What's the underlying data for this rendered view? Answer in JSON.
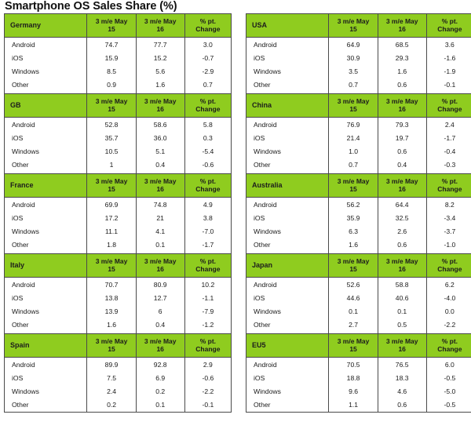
{
  "title": "Smartphone OS Sales Share (%)",
  "columns": {
    "region_header_note": "region name occupies first column header",
    "period1": "3 m/e May 15",
    "period1_line1": "3 m/e May",
    "period1_line2": "15",
    "period2": "3 m/e May 16",
    "period2_line1": "3 m/e May",
    "period2_line2": "16",
    "change_line1": "% pt.",
    "change_line2": "Change"
  },
  "os_labels": [
    "Android",
    "iOS",
    "Windows",
    "Other"
  ],
  "colors": {
    "header_green": "#8fcc1f",
    "border": "#4a4a4a",
    "text": "#1a1a1a",
    "background": "#ffffff"
  },
  "left_column": [
    {
      "region": "Germany",
      "rows": [
        {
          "os": "Android",
          "v1": "74.7",
          "v2": "77.7",
          "change": "3.0"
        },
        {
          "os": "iOS",
          "v1": "15.9",
          "v2": "15.2",
          "change": "-0.7"
        },
        {
          "os": "Windows",
          "v1": "8.5",
          "v2": "5.6",
          "change": "-2.9"
        },
        {
          "os": "Other",
          "v1": "0.9",
          "v2": "1.6",
          "change": "0.7"
        }
      ]
    },
    {
      "region": "GB",
      "rows": [
        {
          "os": "Android",
          "v1": "52.8",
          "v2": "58.6",
          "change": "5.8"
        },
        {
          "os": "iOS",
          "v1": "35.7",
          "v2": "36.0",
          "change": "0.3"
        },
        {
          "os": "Windows",
          "v1": "10.5",
          "v2": "5.1",
          "change": "-5.4"
        },
        {
          "os": "Other",
          "v1": "1",
          "v2": "0.4",
          "change": "-0.6"
        }
      ]
    },
    {
      "region": "France",
      "rows": [
        {
          "os": "Android",
          "v1": "69.9",
          "v2": "74.8",
          "change": "4.9"
        },
        {
          "os": "iOS",
          "v1": "17.2",
          "v2": "21",
          "change": "3.8"
        },
        {
          "os": "Windows",
          "v1": "11.1",
          "v2": "4.1",
          "change": "-7.0"
        },
        {
          "os": "Other",
          "v1": "1.8",
          "v2": "0.1",
          "change": "-1.7"
        }
      ]
    },
    {
      "region": "Italy",
      "rows": [
        {
          "os": "Android",
          "v1": "70.7",
          "v2": "80.9",
          "change": "10.2"
        },
        {
          "os": "iOS",
          "v1": "13.8",
          "v2": "12.7",
          "change": "-1.1"
        },
        {
          "os": "Windows",
          "v1": "13.9",
          "v2": "6",
          "change": "-7.9"
        },
        {
          "os": "Other",
          "v1": "1.6",
          "v2": "0.4",
          "change": "-1.2"
        }
      ]
    },
    {
      "region": "Spain",
      "rows": [
        {
          "os": "Android",
          "v1": "89.9",
          "v2": "92.8",
          "change": "2.9"
        },
        {
          "os": "iOS",
          "v1": "7.5",
          "v2": "6.9",
          "change": "-0.6"
        },
        {
          "os": "Windows",
          "v1": "2.4",
          "v2": "0.2",
          "change": "-2.2"
        },
        {
          "os": "Other",
          "v1": "0.2",
          "v2": "0.1",
          "change": "-0.1"
        }
      ]
    }
  ],
  "right_column": [
    {
      "region": "USA",
      "rows": [
        {
          "os": "Android",
          "v1": "64.9",
          "v2": "68.5",
          "change": "3.6"
        },
        {
          "os": "iOS",
          "v1": "30.9",
          "v2": "29.3",
          "change": "-1.6"
        },
        {
          "os": "Windows",
          "v1": "3.5",
          "v2": "1.6",
          "change": "-1.9"
        },
        {
          "os": "Other",
          "v1": "0.7",
          "v2": "0.6",
          "change": "-0.1"
        }
      ]
    },
    {
      "region": "China",
      "rows": [
        {
          "os": "Android",
          "v1": "76.9",
          "v2": "79.3",
          "change": "2.4"
        },
        {
          "os": "iOS",
          "v1": "21.4",
          "v2": "19.7",
          "change": "-1.7"
        },
        {
          "os": "Windows",
          "v1": "1.0",
          "v2": "0.6",
          "change": "-0.4"
        },
        {
          "os": "Other",
          "v1": "0.7",
          "v2": "0.4",
          "change": "-0.3"
        }
      ]
    },
    {
      "region": "Australia",
      "rows": [
        {
          "os": "Android",
          "v1": "56.2",
          "v2": "64.4",
          "change": "8.2"
        },
        {
          "os": "iOS",
          "v1": "35.9",
          "v2": "32.5",
          "change": "-3.4"
        },
        {
          "os": "Windows",
          "v1": "6.3",
          "v2": "2.6",
          "change": "-3.7"
        },
        {
          "os": "Other",
          "v1": "1.6",
          "v2": "0.6",
          "change": "-1.0"
        }
      ]
    },
    {
      "region": "Japan",
      "rows": [
        {
          "os": "Android",
          "v1": "52.6",
          "v2": "58.8",
          "change": "6.2"
        },
        {
          "os": "iOS",
          "v1": "44.6",
          "v2": "40.6",
          "change": "-4.0"
        },
        {
          "os": "Windows",
          "v1": "0.1",
          "v2": "0.1",
          "change": "0.0"
        },
        {
          "os": "Other",
          "v1": "2.7",
          "v2": "0.5",
          "change": "-2.2"
        }
      ]
    },
    {
      "region": "EU5",
      "rows": [
        {
          "os": "Android",
          "v1": "70.5",
          "v2": "76.5",
          "change": "6.0"
        },
        {
          "os": "iOS",
          "v1": "18.8",
          "v2": "18.3",
          "change": "-0.5"
        },
        {
          "os": "Windows",
          "v1": "9.6",
          "v2": "4.6",
          "change": "-5.0"
        },
        {
          "os": "Other",
          "v1": "1.1",
          "v2": "0.6",
          "change": "-0.5"
        }
      ]
    }
  ],
  "chart_data": {
    "type": "table",
    "title": "Smartphone OS Sales Share (%)",
    "categories": [
      "Android",
      "iOS",
      "Windows",
      "Other"
    ],
    "columns": [
      "3 m/e May 15",
      "3 m/e May 16",
      "% pt. Change"
    ],
    "regions": [
      {
        "name": "Germany",
        "3 m/e May 15": [
          74.7,
          15.9,
          8.5,
          0.9
        ],
        "3 m/e May 16": [
          77.7,
          15.2,
          5.6,
          1.6
        ],
        "% pt. Change": [
          3.0,
          -0.7,
          -2.9,
          0.7
        ]
      },
      {
        "name": "USA",
        "3 m/e May 15": [
          64.9,
          30.9,
          3.5,
          0.7
        ],
        "3 m/e May 16": [
          68.5,
          29.3,
          1.6,
          0.6
        ],
        "% pt. Change": [
          3.6,
          -1.6,
          -1.9,
          -0.1
        ]
      },
      {
        "name": "GB",
        "3 m/e May 15": [
          52.8,
          35.7,
          10.5,
          1.0
        ],
        "3 m/e May 16": [
          58.6,
          36.0,
          5.1,
          0.4
        ],
        "% pt. Change": [
          5.8,
          0.3,
          -5.4,
          -0.6
        ]
      },
      {
        "name": "China",
        "3 m/e May 15": [
          76.9,
          21.4,
          1.0,
          0.7
        ],
        "3 m/e May 16": [
          79.3,
          19.7,
          0.6,
          0.4
        ],
        "% pt. Change": [
          2.4,
          -1.7,
          -0.4,
          -0.3
        ]
      },
      {
        "name": "France",
        "3 m/e May 15": [
          69.9,
          17.2,
          11.1,
          1.8
        ],
        "3 m/e May 16": [
          74.8,
          21.0,
          4.1,
          0.1
        ],
        "% pt. Change": [
          4.9,
          3.8,
          -7.0,
          -1.7
        ]
      },
      {
        "name": "Australia",
        "3 m/e May 15": [
          56.2,
          35.9,
          6.3,
          1.6
        ],
        "3 m/e May 16": [
          64.4,
          32.5,
          2.6,
          0.6
        ],
        "% pt. Change": [
          8.2,
          -3.4,
          -3.7,
          -1.0
        ]
      },
      {
        "name": "Italy",
        "3 m/e May 15": [
          70.7,
          13.8,
          13.9,
          1.6
        ],
        "3 m/e May 16": [
          80.9,
          12.7,
          6.0,
          0.4
        ],
        "% pt. Change": [
          10.2,
          -1.1,
          -7.9,
          -1.2
        ]
      },
      {
        "name": "Japan",
        "3 m/e May 15": [
          52.6,
          44.6,
          0.1,
          2.7
        ],
        "3 m/e May 16": [
          58.8,
          40.6,
          0.1,
          0.5
        ],
        "% pt. Change": [
          6.2,
          -4.0,
          0.0,
          -2.2
        ]
      },
      {
        "name": "Spain",
        "3 m/e May 15": [
          89.9,
          7.5,
          2.4,
          0.2
        ],
        "3 m/e May 16": [
          92.8,
          6.9,
          0.2,
          0.1
        ],
        "% pt. Change": [
          2.9,
          -0.6,
          -2.2,
          -0.1
        ]
      },
      {
        "name": "EU5",
        "3 m/e May 15": [
          70.5,
          18.8,
          9.6,
          1.1
        ],
        "3 m/e May 16": [
          76.5,
          18.3,
          4.6,
          0.6
        ],
        "% pt. Change": [
          6.0,
          -0.5,
          -5.0,
          -0.5
        ]
      }
    ]
  }
}
